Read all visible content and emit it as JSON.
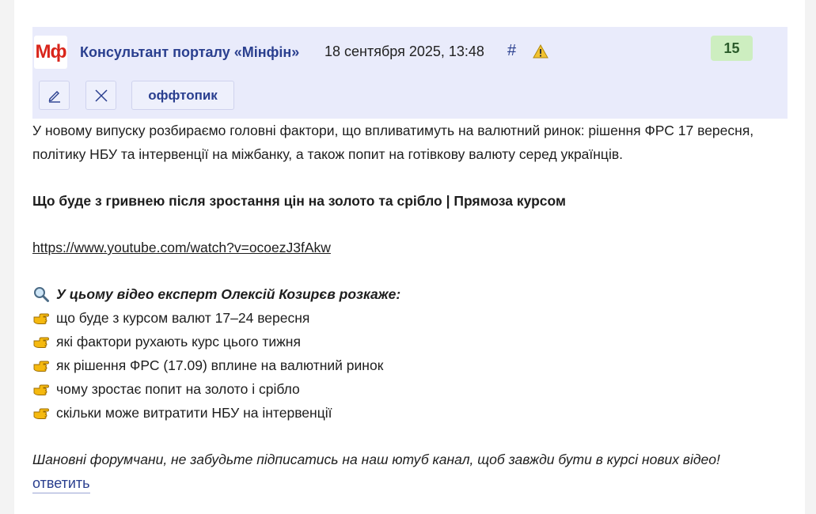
{
  "post": {
    "logo_text": "Мф",
    "author": "Консультант порталу «Мінфін»",
    "datetime": "18 сентября 2025, 13:48",
    "hash": "#",
    "rating": "15",
    "tag_label": "оффтопик",
    "accent_color": "#2a3f8f",
    "logo_color": "#d9261c"
  },
  "content": {
    "intro": "У новому випуску розбираємо головні фактори, що впливатимуть на валютний ринок: рішення ФРС 17 вересня, політику НБУ та інтервенції на міжбанку, а також попит на готівкову валюту серед українців.",
    "headline": "Що буде з гривнею після зростання цін на золото та срібло | Прямоза курсом",
    "url": "https://www.youtube.com/watch?v=ocoezJ3fAkw",
    "expert_line": "У цьому відео експерт Олексій Козирєв розкаже:",
    "points": [
      "що буде з курсом валют 17–24 вересня",
      "які фактори рухають курс цього тижня",
      "як рішення ФРС (17.09) вплине на валютний ринок",
      "чому зростає попит на золото і срібло",
      "скільки може витратити НБУ на інтервенції"
    ],
    "closing": "Шановні форумчани, не забудьте підписатись на наш ютуб канал, щоб завжди бути в курсі нових відео!"
  },
  "actions": {
    "reply": "ответить"
  },
  "icons": {
    "search": "magnifier-icon",
    "point": "pointing-hand-icon",
    "warning": "warning-icon",
    "edit": "pencil-icon",
    "close": "close-icon"
  }
}
